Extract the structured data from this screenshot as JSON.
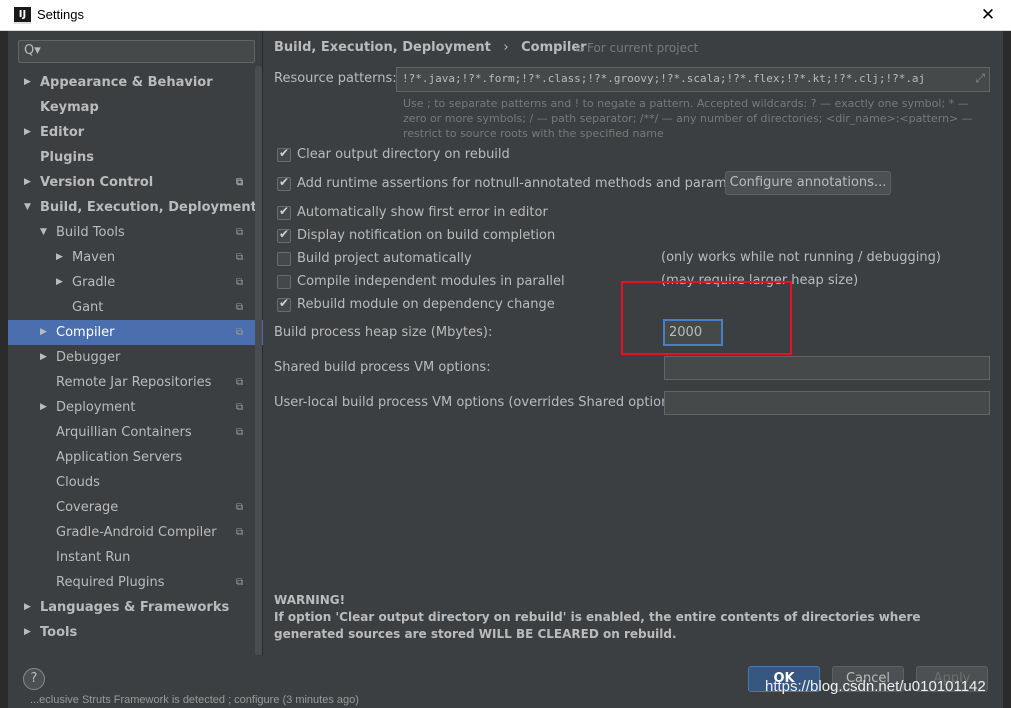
{
  "window": {
    "title": "Settings",
    "app_icon": "IJ",
    "close_glyph": "✕"
  },
  "search": {
    "icon": "search-icon",
    "placeholder": "Q▾"
  },
  "tree": [
    {
      "label": "Appearance & Behavior",
      "level": 0,
      "arrow": "▶",
      "bold": true,
      "copy": false
    },
    {
      "label": "Keymap",
      "level": 0,
      "arrow": "",
      "bold": true,
      "copy": false
    },
    {
      "label": "Editor",
      "level": 0,
      "arrow": "▶",
      "bold": true,
      "copy": false
    },
    {
      "label": "Plugins",
      "level": 0,
      "arrow": "",
      "bold": true,
      "copy": false
    },
    {
      "label": "Version Control",
      "level": 0,
      "arrow": "▶",
      "bold": true,
      "copy": true
    },
    {
      "label": "Build, Execution, Deployment",
      "level": 0,
      "arrow": "▼",
      "bold": true,
      "copy": false
    },
    {
      "label": "Build Tools",
      "level": 1,
      "arrow": "▼",
      "bold": false,
      "copy": true
    },
    {
      "label": "Maven",
      "level": 2,
      "arrow": "▶",
      "bold": false,
      "copy": true
    },
    {
      "label": "Gradle",
      "level": 2,
      "arrow": "▶",
      "bold": false,
      "copy": true
    },
    {
      "label": "Gant",
      "level": 2,
      "arrow": "",
      "bold": false,
      "copy": true
    },
    {
      "label": "Compiler",
      "level": 1,
      "arrow": "▶",
      "bold": false,
      "copy": true,
      "selected": true
    },
    {
      "label": "Debugger",
      "level": 1,
      "arrow": "▶",
      "bold": false,
      "copy": false
    },
    {
      "label": "Remote Jar Repositories",
      "level": 1,
      "arrow": "",
      "bold": false,
      "copy": true
    },
    {
      "label": "Deployment",
      "level": 1,
      "arrow": "▶",
      "bold": false,
      "copy": true
    },
    {
      "label": "Arquillian Containers",
      "level": 1,
      "arrow": "",
      "bold": false,
      "copy": true
    },
    {
      "label": "Application Servers",
      "level": 1,
      "arrow": "",
      "bold": false,
      "copy": false
    },
    {
      "label": "Clouds",
      "level": 1,
      "arrow": "",
      "bold": false,
      "copy": false
    },
    {
      "label": "Coverage",
      "level": 1,
      "arrow": "",
      "bold": false,
      "copy": true
    },
    {
      "label": "Gradle-Android Compiler",
      "level": 1,
      "arrow": "",
      "bold": false,
      "copy": true
    },
    {
      "label": "Instant Run",
      "level": 1,
      "arrow": "",
      "bold": false,
      "copy": false
    },
    {
      "label": "Required Plugins",
      "level": 1,
      "arrow": "",
      "bold": false,
      "copy": true
    },
    {
      "label": "Languages & Frameworks",
      "level": 0,
      "arrow": "▶",
      "bold": true,
      "copy": false
    },
    {
      "label": "Tools",
      "level": 0,
      "arrow": "▶",
      "bold": true,
      "copy": false
    }
  ],
  "breadcrumb": {
    "section": "Build, Execution, Deployment",
    "separator": "›",
    "page": "Compiler",
    "scope_icon": "copy-icon",
    "scope_label": "For current project"
  },
  "resource_patterns": {
    "label": "Resource patterns:",
    "value": "!?*.java;!?*.form;!?*.class;!?*.groovy;!?*.scala;!?*.flex;!?*.kt;!?*.clj;!?*.aj",
    "hint": "Use ; to separate patterns and ! to negate a pattern. Accepted wildcards: ? — exactly one symbol; * — zero or more symbols; / — path separator; /**/ — any number of directories; <dir_name>:<pattern> — restrict to source roots with the specified name"
  },
  "options": [
    {
      "label": "Clear output directory on rebuild",
      "checked": true
    },
    {
      "label": "Add runtime assertions for notnull-annotated methods and parameters",
      "checked": true
    },
    {
      "label": "Automatically show first error in editor",
      "checked": true
    },
    {
      "label": "Display notification on build completion",
      "checked": true
    },
    {
      "label": "Build project automatically",
      "checked": false
    },
    {
      "label": "Compile independent modules in parallel",
      "checked": false
    },
    {
      "label": "Rebuild module on dependency change",
      "checked": true
    }
  ],
  "configure_button": "Configure annotations...",
  "note_build_auto": "(only works while not running / debugging)",
  "note_parallel": "(may require larger heap size)",
  "heap": {
    "label": "Build process heap size (Mbytes):",
    "value": "2000"
  },
  "shared_vm": {
    "label": "Shared build process VM options:",
    "value": ""
  },
  "user_vm": {
    "label": "User-local build process VM options (overrides Shared options):",
    "value": ""
  },
  "warning": {
    "title": "WARNING!",
    "text": "If option 'Clear output directory on rebuild' is enabled, the entire contents of directories where generated sources are stored WILL BE CLEARED on rebuild."
  },
  "footer": {
    "help": "?",
    "ok": "OK",
    "cancel": "Cancel",
    "apply": "Apply"
  },
  "watermark": "https://blog.csdn.net/u010101142",
  "background_text": "...eclusive Struts Framework is detected ; configure (3 minutes ago)",
  "colors": {
    "selection": "#4b6eaf",
    "background": "#3c3f41",
    "highlight": "#e81123",
    "ok_button": "#365880"
  }
}
